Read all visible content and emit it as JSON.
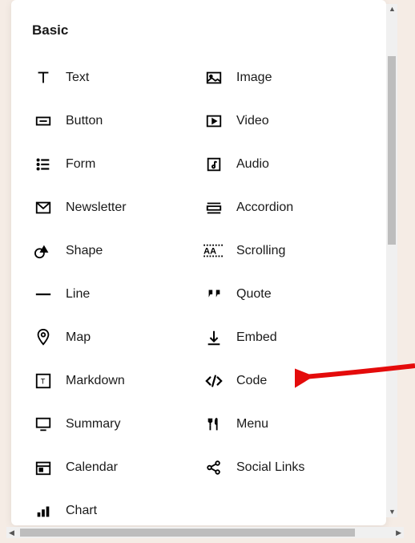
{
  "section": {
    "title": "Basic",
    "items_left": [
      {
        "key": "text",
        "label": "Text"
      },
      {
        "key": "button",
        "label": "Button"
      },
      {
        "key": "form",
        "label": "Form"
      },
      {
        "key": "newsletter",
        "label": "Newsletter"
      },
      {
        "key": "shape",
        "label": "Shape"
      },
      {
        "key": "line",
        "label": "Line"
      },
      {
        "key": "map",
        "label": "Map"
      },
      {
        "key": "markdown",
        "label": "Markdown"
      },
      {
        "key": "summary",
        "label": "Summary"
      },
      {
        "key": "calendar",
        "label": "Calendar"
      },
      {
        "key": "chart",
        "label": "Chart"
      }
    ],
    "items_right": [
      {
        "key": "image",
        "label": "Image"
      },
      {
        "key": "video",
        "label": "Video"
      },
      {
        "key": "audio",
        "label": "Audio"
      },
      {
        "key": "accordion",
        "label": "Accordion"
      },
      {
        "key": "scrolling",
        "label": "Scrolling"
      },
      {
        "key": "quote",
        "label": "Quote"
      },
      {
        "key": "embed",
        "label": "Embed"
      },
      {
        "key": "code",
        "label": "Code"
      },
      {
        "key": "menu",
        "label": "Menu"
      },
      {
        "key": "social",
        "label": "Social Links"
      }
    ]
  },
  "annotation": {
    "target": "code"
  }
}
